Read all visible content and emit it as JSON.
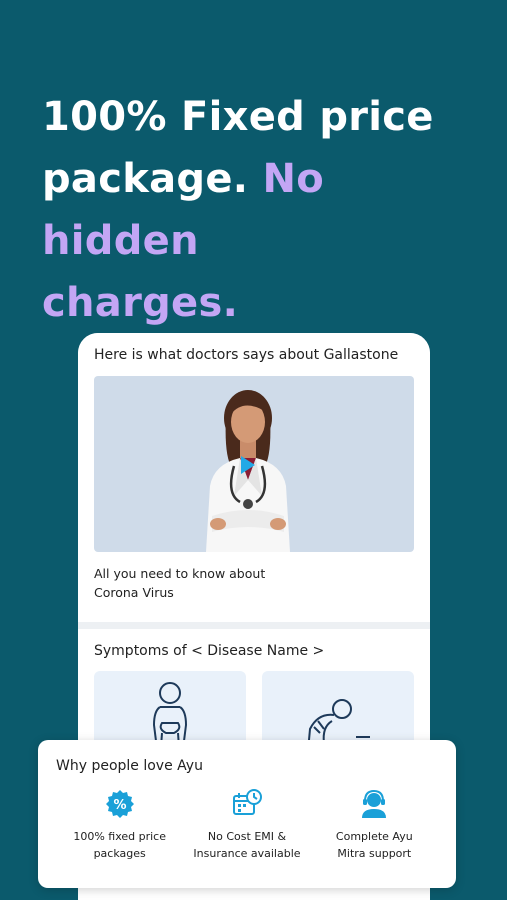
{
  "headline": {
    "line1": "100% Fixed price",
    "line2_plain": "package.",
    "line2_highlight": "No hidden",
    "line3_highlight": "charges."
  },
  "doctors_section": {
    "title": "Here is what doctors says about Gallastone",
    "video_caption_line1": "All you need to know about",
    "video_caption_line2": "Corona Virus"
  },
  "symptoms_section": {
    "title": "Symptoms of < Disease Name >"
  },
  "why_love": {
    "title": "Why people love Ayu",
    "features": [
      {
        "icon": "percent-badge-icon",
        "line1": "100% fixed price",
        "line2": "packages"
      },
      {
        "icon": "calendar-clock-icon",
        "line1": "No Cost EMI &",
        "line2": "Insurance available"
      },
      {
        "icon": "support-agent-icon",
        "line1": "Complete Ayu",
        "line2": "Mitra support"
      }
    ]
  },
  "colors": {
    "background": "#0b5a6c",
    "highlight": "#c3a6f5",
    "icon_blue": "#1aa0d8"
  }
}
